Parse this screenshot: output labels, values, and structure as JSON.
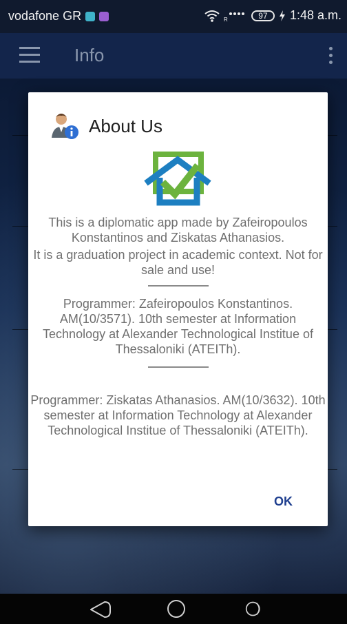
{
  "status_bar": {
    "carrier": "vodafone GR",
    "battery": "97",
    "time": "1:48 a.m."
  },
  "app_bar": {
    "title": "Info"
  },
  "dialog": {
    "title": "About Us",
    "paragraph1": "This is a diplomatic app made by Zafeiropoulos Konstantinos and Ziskatas Athanasios.",
    "paragraph2": "It is a graduation project in academic context. Not for sale and use!",
    "programmer1": "Programmer: Zafeiropoulos Konstantinos. AM(10/3571).  10th semester at Information Technology at Alexander Technological Institue of Thessaloniki (ATEITh).",
    "programmer2": "Programmer: Ziskatas Athanasios. AM(10/3632). 10th semester at Information Technology at Alexander Technological Institue of Thessaloniki (ATEITh).",
    "ok_label": "OK"
  },
  "colors": {
    "accent": "#1f3f8f",
    "logo_green": "#6cb33e",
    "logo_blue": "#1d7fc1"
  }
}
